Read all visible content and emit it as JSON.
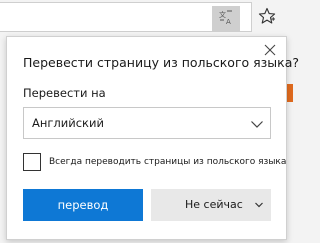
{
  "browser": {
    "icons": {
      "translate": "translate-icon",
      "favorite": "star-icon"
    }
  },
  "dialog": {
    "title": "Перевести страницу из польского языка?",
    "translate_to_label": "Перевести на",
    "target_language": "Английский",
    "always_translate_label": "Всегда переводить страницы из польского языка",
    "always_translate_checked": false,
    "translate_button": "перевод",
    "not_now_button": "Не сейчас",
    "icons": {
      "close": "close-icon",
      "dropdown": "chevron-down-icon"
    },
    "colors": {
      "primary": "#0e78d5",
      "secondary_button": "#e8e8e8",
      "translate_icon_bg": "#cfcfcf"
    }
  }
}
